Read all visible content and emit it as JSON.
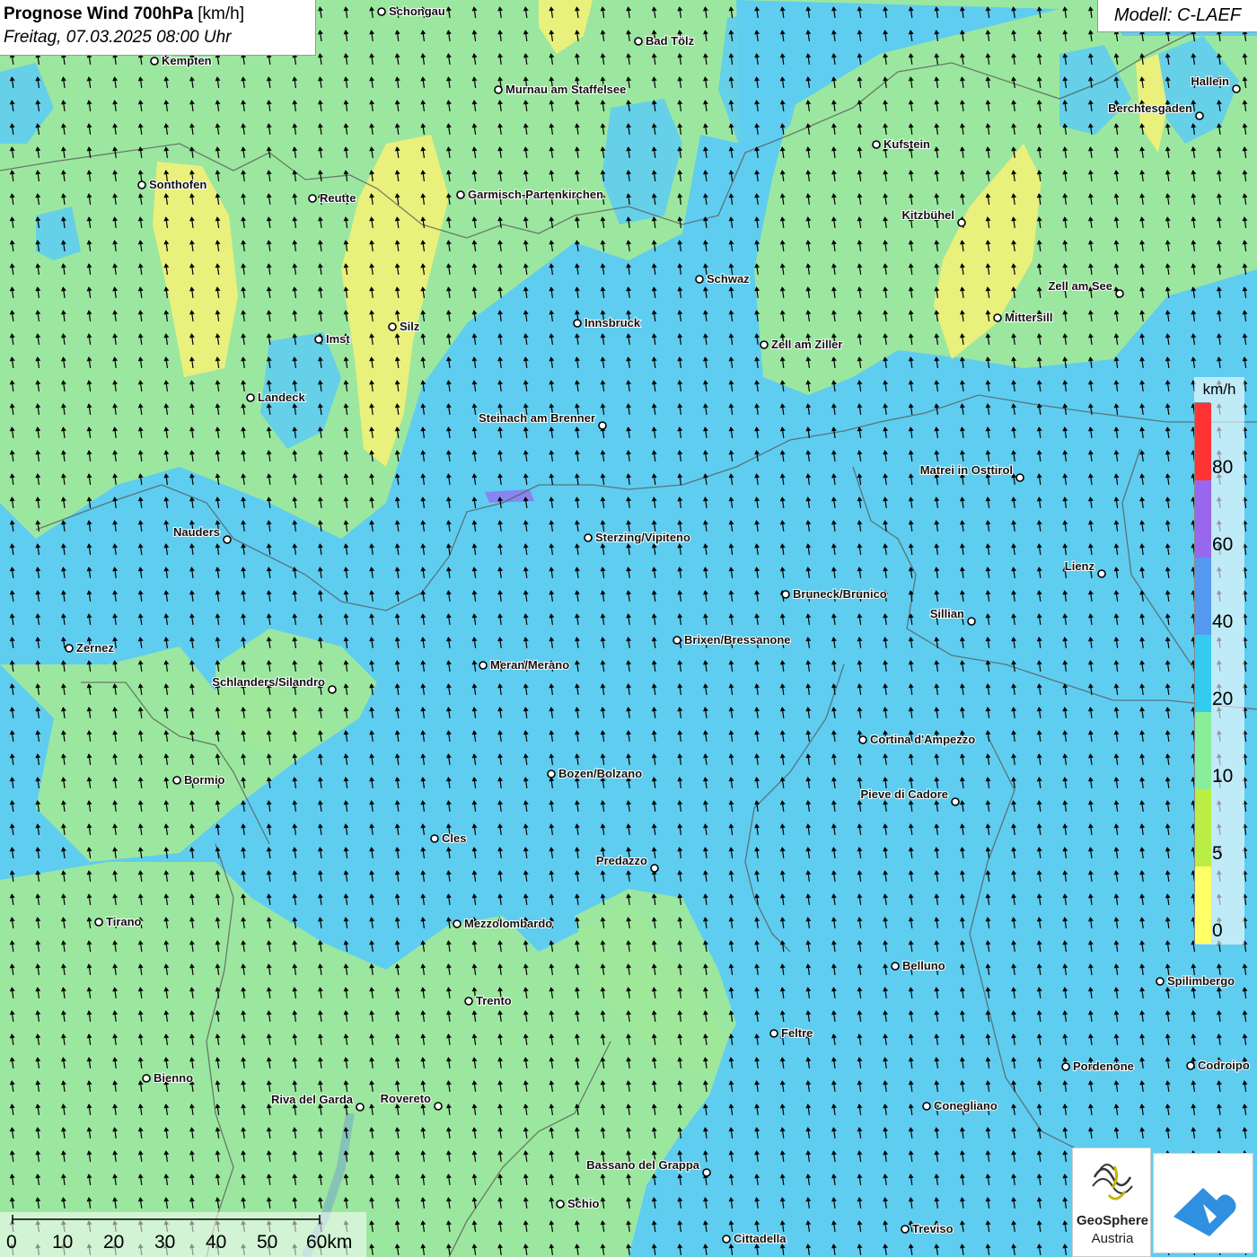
{
  "title": {
    "main": "Prognose Wind 700hPa",
    "unit": "[km/h]",
    "datetime": "Freitag, 07.03.2025 08:00 Uhr"
  },
  "model_label": "Modell: C-LAEF",
  "legend": {
    "unit": "km/h",
    "ticks": [
      "80",
      "60",
      "40",
      "20",
      "10",
      "5",
      "0"
    ],
    "colors": [
      "#ff3333",
      "#9966ee",
      "#5599f0",
      "#33ccf0",
      "#88ee99",
      "#bbee44",
      "#ffff66"
    ]
  },
  "scalebar": {
    "labels": [
      "0",
      "10",
      "20",
      "30",
      "40",
      "50",
      "60km"
    ]
  },
  "logos": {
    "geosphere_name": "GeoSphere",
    "geosphere_sub": "Austria"
  },
  "colors": {
    "calm_yellow": "#eef07a",
    "light_green": "#9fe89a",
    "cyan": "#5fcdf0"
  },
  "wind_direction": "south (arrows pointing north)",
  "cities": [
    {
      "name": "Schongau"
    },
    {
      "name": "Bad Tölz"
    },
    {
      "name": "Kempten"
    },
    {
      "name": "Murnau am Staffelsee"
    },
    {
      "name": "Hallein"
    },
    {
      "name": "Berchtesgaden"
    },
    {
      "name": "Kufstein"
    },
    {
      "name": "Sonthofen"
    },
    {
      "name": "Reutte"
    },
    {
      "name": "Garmisch-Partenkirchen"
    },
    {
      "name": "Kitzbühel"
    },
    {
      "name": "Schwaz"
    },
    {
      "name": "Zell am See"
    },
    {
      "name": "Mittersill"
    },
    {
      "name": "Silz"
    },
    {
      "name": "Imst"
    },
    {
      "name": "Innsbruck"
    },
    {
      "name": "Zell am Ziller"
    },
    {
      "name": "Landeck"
    },
    {
      "name": "Steinach am Brenner"
    },
    {
      "name": "Matrei in Osttirol"
    },
    {
      "name": "Nauders"
    },
    {
      "name": "Sterzing/Vipiteno"
    },
    {
      "name": "Lienz"
    },
    {
      "name": "Bruneck/Brunico"
    },
    {
      "name": "Sillian"
    },
    {
      "name": "Brixen/Bressanone"
    },
    {
      "name": "Zernez"
    },
    {
      "name": "Meran/Merano"
    },
    {
      "name": "Schlanders/Silandro"
    },
    {
      "name": "Cortina d'Ampezzo"
    },
    {
      "name": "Bozen/Bolzano"
    },
    {
      "name": "Bormio"
    },
    {
      "name": "Pieve di Cadore"
    },
    {
      "name": "Cles"
    },
    {
      "name": "Predazzo"
    },
    {
      "name": "Tirano"
    },
    {
      "name": "Mezzolombardo"
    },
    {
      "name": "Belluno"
    },
    {
      "name": "Spilimbergo"
    },
    {
      "name": "Trento"
    },
    {
      "name": "Feltre"
    },
    {
      "name": "Pordenone"
    },
    {
      "name": "Codroipo"
    },
    {
      "name": "Bienno"
    },
    {
      "name": "Riva del Garda"
    },
    {
      "name": "Rovereto"
    },
    {
      "name": "Conegliano"
    },
    {
      "name": "Bassano del Grappa"
    },
    {
      "name": "Schio"
    },
    {
      "name": "Treviso"
    },
    {
      "name": "Cittadella"
    }
  ]
}
